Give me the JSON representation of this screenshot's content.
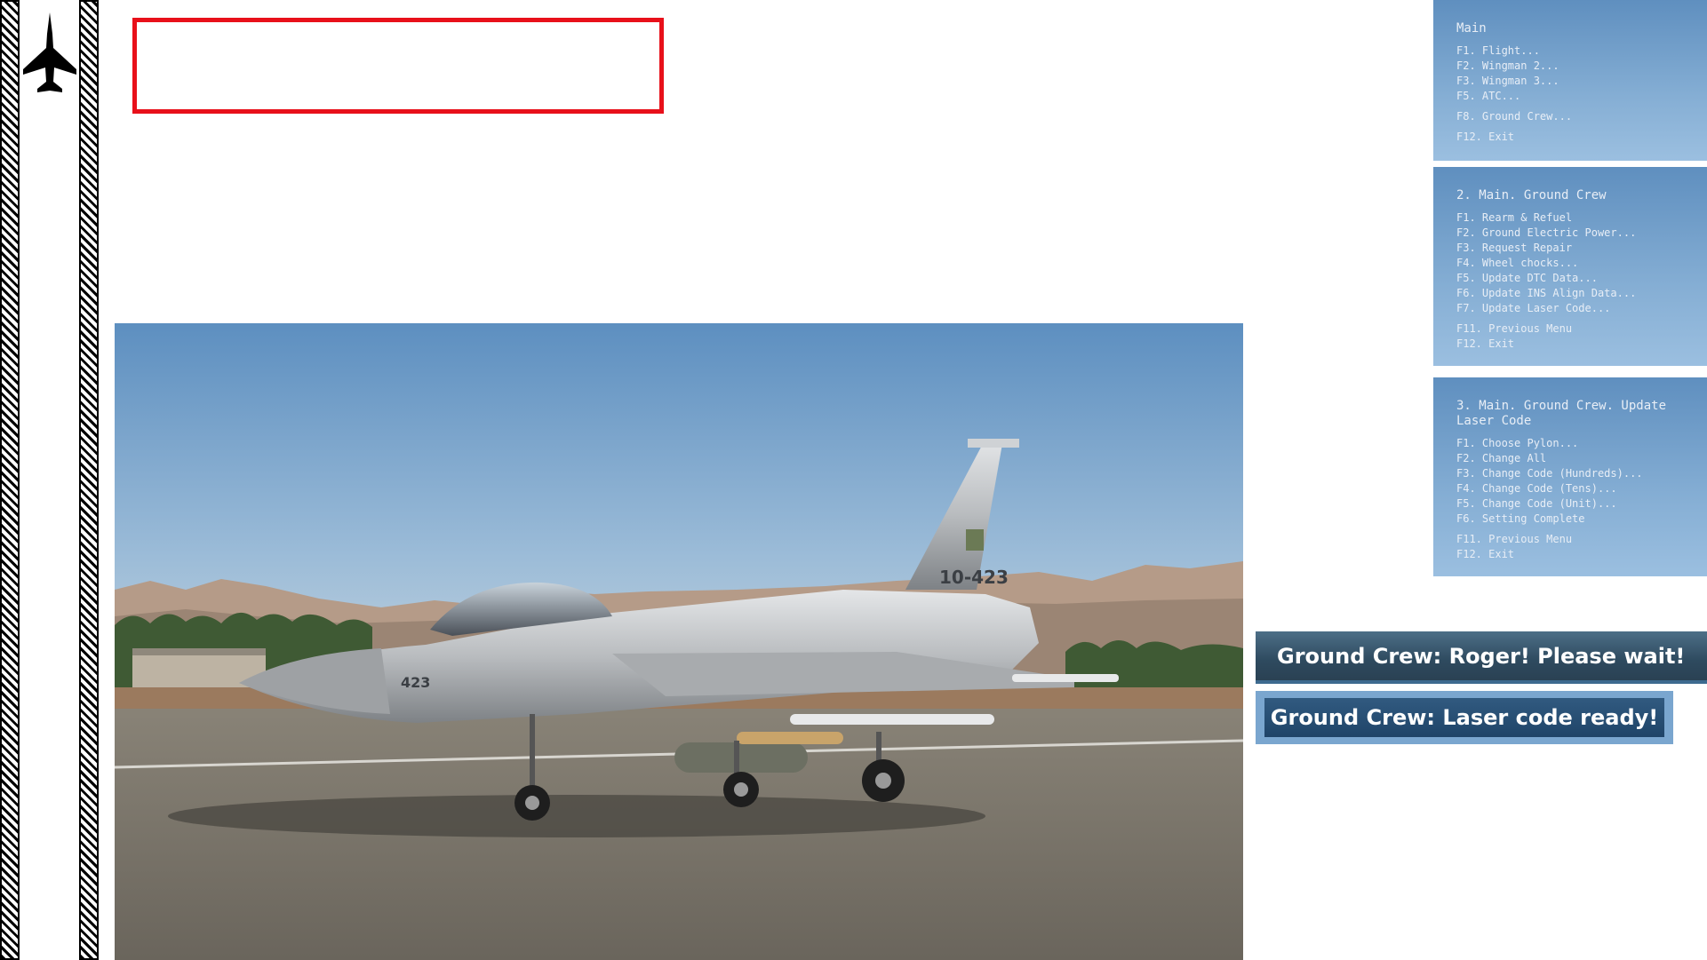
{
  "sidebar": {
    "logo_icon": "fighter-jet-icon"
  },
  "menus": [
    {
      "title": "Main",
      "items": [
        "F1. Flight...",
        "F2. Wingman 2...",
        "F3. Wingman 3...",
        "F5. ATC...",
        "F8. Ground Crew...",
        "F12. Exit"
      ]
    },
    {
      "title": "2. Main. Ground Crew",
      "items": [
        "F1. Rearm & Refuel",
        "F2. Ground Electric Power...",
        "F3. Request Repair",
        "F4. Wheel chocks...",
        "F5. Update DTC Data...",
        "F6. Update INS Align Data...",
        "F7. Update Laser Code...",
        "F11. Previous Menu",
        "F12. Exit"
      ]
    },
    {
      "title": "3. Main. Ground Crew. Update Laser Code",
      "items": [
        "F1. Choose Pylon...",
        "F2. Change All",
        "F3. Change Code (Hundreds)...",
        "F4. Change Code (Tens)...",
        "F5. Change Code (Unit)...",
        "F6. Setting Complete",
        "F11. Previous Menu",
        "F12. Exit"
      ]
    }
  ],
  "messages": {
    "first": "Ground Crew: Roger! Please wait!",
    "second": "Ground Crew: Laser code ready!"
  },
  "aircraft": {
    "nose_number": "423",
    "tail_number": "10-423"
  },
  "colors": {
    "callout_border": "#e8101a",
    "menu_text": "#e8eef6"
  }
}
